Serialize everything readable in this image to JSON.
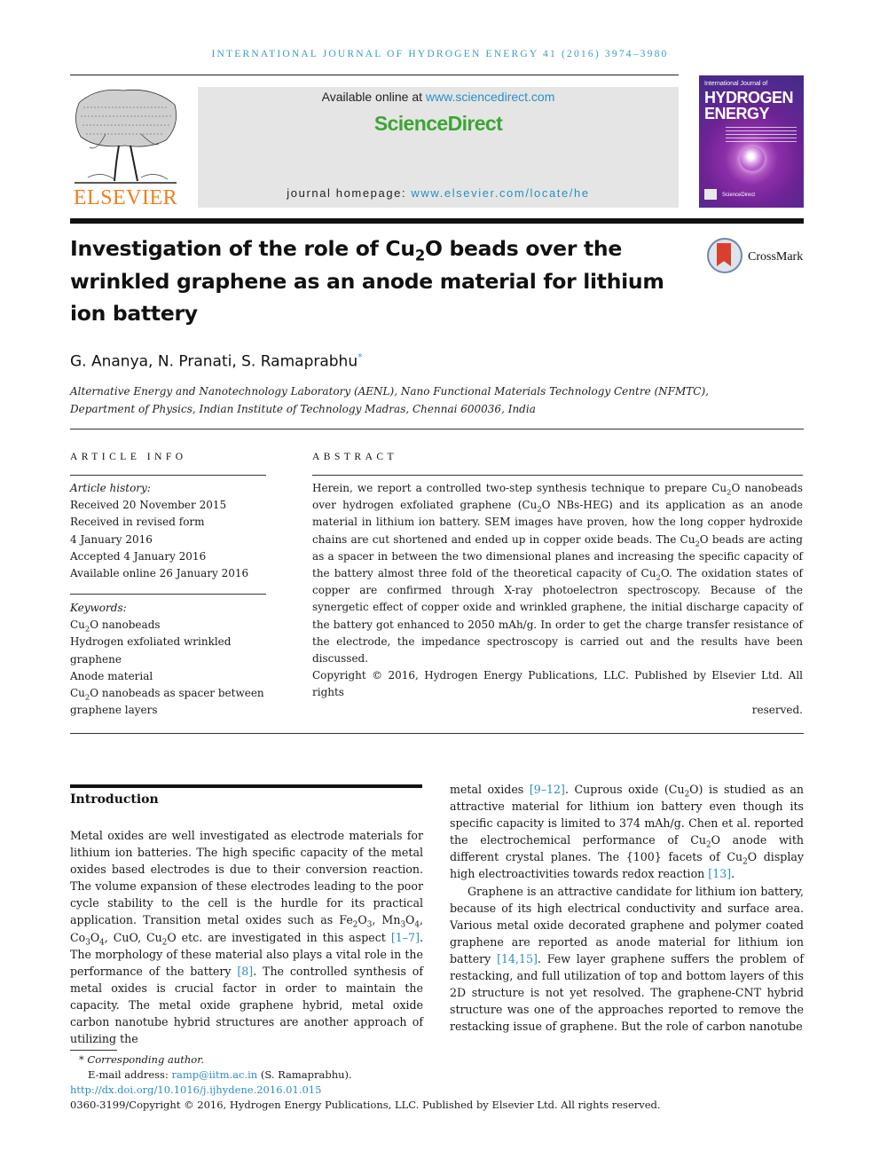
{
  "header": {
    "running_head": "INTERNATIONAL JOURNAL OF HYDROGEN ENERGY 41 (2016) 3974–3980",
    "publisher_logo_text": "ELSEVIER",
    "available_online_prefix": "Available online at ",
    "available_online_link": "www.sciencedirect.com",
    "sciencedirect_logo": "ScienceDirect",
    "journal_homepage_prefix": "journal homepage: ",
    "journal_homepage_link": "www.elsevier.com/locate/he",
    "cover": {
      "line1": "International Journal of",
      "line2": "HYDROGEN",
      "line3": "ENERGY",
      "footer": "ScienceDirect"
    },
    "crossmark_label": "CrossMark"
  },
  "article": {
    "title_part1": "Investigation of the role of Cu",
    "title_sub": "2",
    "title_part2": "O beads over the wrinkled graphene as an anode material for lithium ion battery",
    "authors": "G. Ananya, N. Pranati, S. Ramaprabhu",
    "corresponding_mark": "*",
    "affiliation_line1": "Alternative Energy and Nanotechnology Laboratory (AENL), Nano Functional Materials Technology Centre (NFMTC),",
    "affiliation_line2": "Department of Physics, Indian Institute of Technology Madras, Chennai 600036, India"
  },
  "article_info": {
    "heading": "ARTICLE INFO",
    "history_label": "Article history:",
    "history": [
      "Received 20 November 2015",
      "Received in revised form",
      "4 January 2016",
      "Accepted 4 January 2016",
      "Available online 26 January 2016"
    ],
    "keywords_label": "Keywords:",
    "keywords": [
      {
        "pre": "Cu",
        "sub": "2",
        "post": "O nanobeads"
      },
      {
        "pre": "Hydrogen exfoliated wrinkled graphene",
        "sub": "",
        "post": ""
      },
      {
        "pre": "Anode material",
        "sub": "",
        "post": ""
      },
      {
        "pre": "Cu",
        "sub": "2",
        "post": "O nanobeads as spacer between graphene layers"
      }
    ]
  },
  "abstract": {
    "heading": "ABSTRACT",
    "s1": "Herein, we report a controlled two-step synthesis technique to prepare Cu",
    "s2": "O nanobeads over hydrogen exfoliated graphene (Cu",
    "s3": "O NBs-HEG) and its application as an anode material in lithium ion battery. SEM images have proven, how the long copper hydroxide chains are cut shortened and ended up in copper oxide beads. The Cu",
    "s4": "O beads are acting as a spacer in between the two dimensional planes and increasing the specific capacity of the battery almost three fold of the theoretical capacity of Cu",
    "s5": "O. The oxidation states of copper are confirmed through X-ray photoelectron spectroscopy. Because of the synergetic effect of copper oxide and wrinkled graphene, the initial discharge capacity of the battery got enhanced to 2050 mAh/g. In order to get the charge transfer resistance of the electrode, the impedance spectroscopy is carried out and the results have been discussed.",
    "sub": "2",
    "copyright": "Copyright © 2016, Hydrogen Energy Publications, LLC. Published by Elsevier Ltd. All rights",
    "copyright_end": "reserved."
  },
  "introduction": {
    "heading": "Introduction",
    "left": {
      "t1": "Metal oxides are well investigated as electrode materials for lithium ion batteries. The high specific capacity of the metal oxides based electrodes is due to their conversion reaction. The volume expansion of these electrodes leading to the poor cycle stability to the cell is the hurdle for its practical application. Transition metal oxides such as Fe",
      "t2": "O",
      "t3": ", Mn",
      "t4": "O",
      "t5": ", Co",
      "t6": "O",
      "t7": ", CuO, Cu",
      "t8": "O etc. are investigated in this aspect ",
      "ref1": "[1–7]",
      "t9": ". The morphology of these material also plays a vital role in the performance of the battery ",
      "ref2": "[8]",
      "t10": ". The controlled synthesis of metal oxides is crucial factor in order to maintain the capacity. The metal oxide graphene hybrid, metal oxide carbon nanotube hybrid structures are another approach of utilizing the"
    },
    "right": {
      "p1a": "metal oxides ",
      "ref3": "[9–12]",
      "p1b": ". Cuprous oxide (Cu",
      "p1c": "O) is studied as an attractive material for lithium ion battery even though its specific capacity is limited to 374 mAh/g. Chen et al. reported the electrochemical performance of Cu",
      "p1d": "O anode with different crystal planes. The {100} facets of Cu",
      "p1e": "O display high electroactivities towards redox reaction ",
      "ref4": "[13]",
      "p1f": ".",
      "p2a": "Graphene is an attractive candidate for lithium ion battery, because of its high electrical conductivity and surface area. Various metal oxide decorated graphene and polymer coated graphene are reported as anode material for lithium ion battery ",
      "ref5": "[14,15]",
      "p2b": ". Few layer graphene suffers the problem of restacking, and full utilization of top and bottom layers of this 2D structure is not yet resolved. The graphene-CNT hybrid structure was one of the approaches reported to remove the restacking issue of graphene. But the role of carbon nanotube"
    },
    "subs": {
      "two": "2",
      "three": "3",
      "four": "4"
    }
  },
  "footnotes": {
    "corresponding": "* Corresponding author.",
    "email_label": "E-mail address: ",
    "email": "ramp@iitm.ac.in",
    "email_name": " (S. Ramaprabhu).",
    "doi": "http://dx.doi.org/10.1016/j.ijhydene.2016.01.015",
    "copyright_line": "0360-3199/Copyright © 2016, Hydrogen Energy Publications, LLC. Published by Elsevier Ltd. All rights reserved."
  }
}
